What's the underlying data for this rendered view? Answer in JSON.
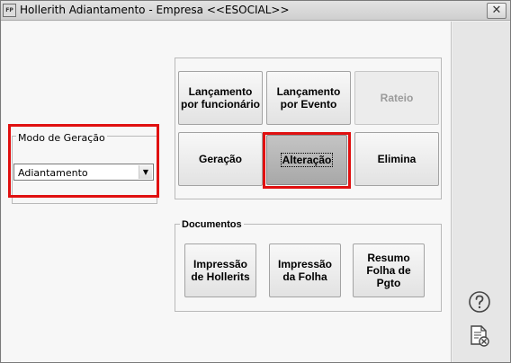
{
  "window": {
    "app_icon_text": "FP",
    "title": "Hollerith Adiantamento - Empresa <<ESOCIAL>>",
    "close_glyph": "✕"
  },
  "modo_geracao": {
    "legend": "Modo de Geração",
    "selected": "Adiantamento"
  },
  "actions": {
    "lancamento_funcionario": "Lançamento por funcionário",
    "lancamento_evento": "Lançamento por Evento",
    "rateio": "Rateio",
    "geracao": "Geração",
    "alteracao": "Alteração",
    "elimina": "Elimina"
  },
  "documentos": {
    "legend": "Documentos",
    "impressao_hollerits": "Impressão de Hollerits",
    "impressao_folha": "Impressão da Folha",
    "resumo_folha": "Resumo Folha de Pgto"
  },
  "icons": {
    "help": "help-circle-icon",
    "report_close": "report-close-icon"
  },
  "colors": {
    "highlight": "#e01010"
  }
}
